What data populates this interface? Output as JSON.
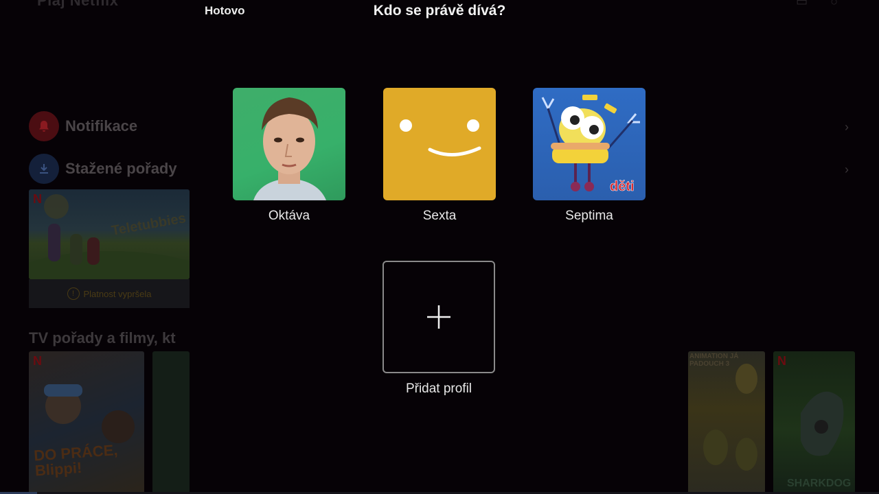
{
  "background": {
    "app_title": "Pláj Netflix",
    "notifications_label": "Notifikace",
    "downloads_label": "Stažené pořady",
    "expired_label": "Platnost vypršela",
    "section_title": "TV pořady a filmy, kt",
    "blippi_title": "DO PRÁCE, Blippi!",
    "minions_title": "ANIMATION JÁ PADOUCH 3",
    "sharkdog_title": "SHARKDOG"
  },
  "overlay": {
    "done_label": "Hotovo",
    "title": "Kdo se právě dívá?",
    "profiles": [
      {
        "name": "Oktáva",
        "avatar": "girl-portrait"
      },
      {
        "name": "Sexta",
        "avatar": "smiley-face"
      },
      {
        "name": "Septima",
        "avatar": "kids-cartoon",
        "badge": "děti"
      }
    ],
    "add_profile_label": "Přidat profil"
  },
  "colors": {
    "sexta_bg": "#e0aa28",
    "oktava_bg": "#3fae6a",
    "septima_bg": "#2f6cc4",
    "kids_badge": "#d4141a"
  }
}
